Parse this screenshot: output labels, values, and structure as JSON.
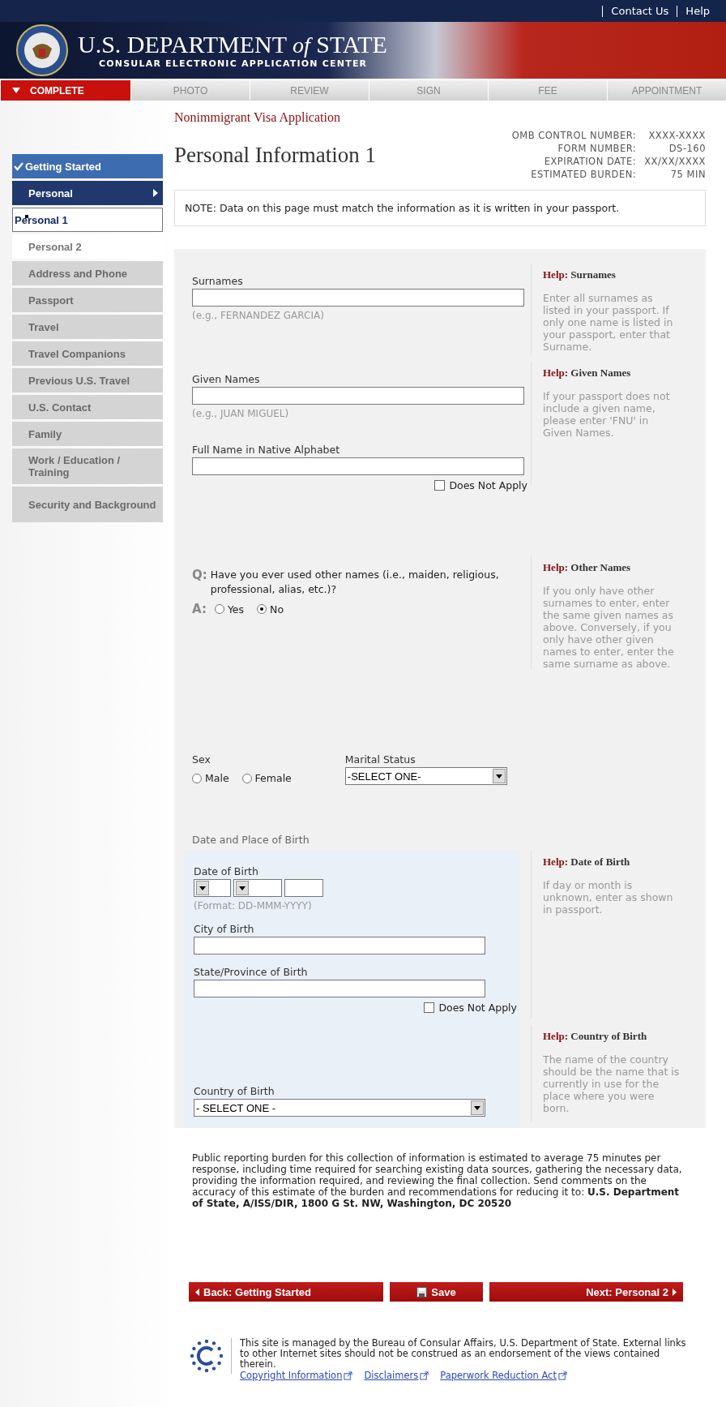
{
  "header": {
    "links": [
      "Contact Us",
      "Help"
    ],
    "title_main": "U.S. DEPARTMENT",
    "title_of": "of",
    "title_end": "STATE",
    "subtitle": "CONSULAR ELECTRONIC APPLICATION CENTER"
  },
  "steps": [
    {
      "label": "COMPLETE",
      "selected": true
    },
    {
      "label": "PHOTO",
      "selected": false
    },
    {
      "label": "REVIEW",
      "selected": false
    },
    {
      "label": "SIGN",
      "selected": false
    },
    {
      "label": "FEE",
      "selected": false
    },
    {
      "label": "APPOINTMENT",
      "selected": false
    }
  ],
  "sidebar": {
    "items": [
      {
        "label": "Getting Started",
        "kind": "completed"
      },
      {
        "label": "Personal",
        "kind": "current"
      },
      {
        "label": "Personal 1",
        "kind": "page",
        "selected": true
      },
      {
        "label": "Personal 2",
        "kind": "page",
        "selected": false
      },
      {
        "label": "Address and Phone",
        "kind": "pending"
      },
      {
        "label": "Passport",
        "kind": "pending"
      },
      {
        "label": "Travel",
        "kind": "pending"
      },
      {
        "label": "Travel Companions",
        "kind": "pending"
      },
      {
        "label": "Previous U.S. Travel",
        "kind": "pending"
      },
      {
        "label": "U.S. Contact",
        "kind": "pending"
      },
      {
        "label": "Family",
        "kind": "pending"
      },
      {
        "label": "Work / Education / Training",
        "kind": "pending"
      },
      {
        "label": "Security and Background",
        "kind": "pending"
      }
    ]
  },
  "app_title": "Nonimmigrant Visa Application",
  "page_title": "Personal Information 1",
  "form_info": [
    {
      "label": "OMB CONTROL NUMBER:",
      "value": "XXXX-XXXX"
    },
    {
      "label": "FORM NUMBER:",
      "value": "DS-160"
    },
    {
      "label": "EXPIRATION DATE:",
      "value": "XX/XX/XXXX"
    },
    {
      "label": "ESTIMATED BURDEN:",
      "value": "75 MIN"
    }
  ],
  "note": "NOTE: Data on this page must match the information as it is written in your passport.",
  "rows": [
    {
      "kind": "fields",
      "fields": [
        {
          "kind": "text",
          "label": "Surnames",
          "hint": "(e.g., FERNANDEZ GARCIA)"
        }
      ],
      "help": {
        "label": "Help:",
        "title": "Surnames",
        "text": "Enter all surnames as listed in your passport. If only one name is listed in your passport, enter that Surname."
      }
    },
    {
      "kind": "fields",
      "fields": [
        {
          "kind": "text",
          "label": "Given Names",
          "hint": "(e.g., JUAN MIGUEL)"
        },
        {
          "kind": "text",
          "label": "Full Name in Native Alphabet",
          "does_not_apply": {
            "label": "Does Not Apply",
            "checked": false
          }
        }
      ],
      "help": {
        "label": "Help:",
        "title": "Given Names",
        "text": "If your passport does not include a given name, please enter 'FNU' in Given Names."
      }
    },
    {
      "kind": "question",
      "q_mark": "Q:",
      "question": "Have you ever used other names (i.e., maiden, religious, professional, alias, etc.)?",
      "a_mark": "A:",
      "options": [
        {
          "label": "Yes",
          "selected": false
        },
        {
          "label": "No",
          "selected": true
        }
      ],
      "help": {
        "label": "Help:",
        "title": "Other Names",
        "text": "If you only have other surnames to enter, enter the same given names as above. Conversely, if you only have other given names to enter, enter the same surname as above."
      }
    },
    {
      "kind": "pair",
      "fields": [
        {
          "kind": "radio",
          "label": "Sex",
          "options": [
            {
              "label": "Male",
              "selected": false
            },
            {
              "label": "Female",
              "selected": false
            }
          ]
        },
        {
          "kind": "select",
          "label": "Marital Status",
          "value": "-SELECT ONE-"
        }
      ]
    },
    {
      "kind": "birth",
      "heading": "Date and Place of Birth",
      "groups": [
        {
          "fields": [
            {
              "kind": "date",
              "label": "Date of Birth",
              "hint": "(Format: DD-MMM-YYYY)"
            },
            {
              "kind": "text",
              "label": "City of Birth"
            },
            {
              "kind": "text",
              "label": "State/Province of Birth",
              "does_not_apply": {
                "label": "Does Not Apply",
                "checked": false
              }
            }
          ],
          "help": {
            "label": "Help:",
            "title": "Date of Birth",
            "text": "If day or month is unknown, enter as shown in passport."
          }
        },
        {
          "fields": [
            {
              "kind": "select",
              "label": "Country of Birth",
              "value": "- SELECT ONE -"
            }
          ],
          "help": {
            "label": "Help:",
            "title": "Country of Birth",
            "text": "The name of the country should be the name that is currently in use for the place where you were born."
          }
        }
      ]
    }
  ],
  "burden": "Public reporting burden for this collection of information is estimated to average 75 minutes per response, including time required for searching existing data sources, gathering the necessary data, providing the information required, and reviewing the final collection. Send comments on the accuracy of this estimate of the burden and recommendations for reducing it to: **U.S. Department of State, A/ISS/DIR, 1800 G St. NW, Washington, DC 20520**",
  "buttons": {
    "back": "Back: Getting Started",
    "save": "Save",
    "next": "Next: Personal 2"
  },
  "footer": {
    "text": "This site is managed by the Bureau of Consular Affairs, U.S. Department of State. External links to other Internet sites should not be construed as an endorsement of the views contained therein.",
    "links": [
      "Copyright Information",
      "Disclaimers",
      "Paperwork Reduction Act"
    ]
  }
}
